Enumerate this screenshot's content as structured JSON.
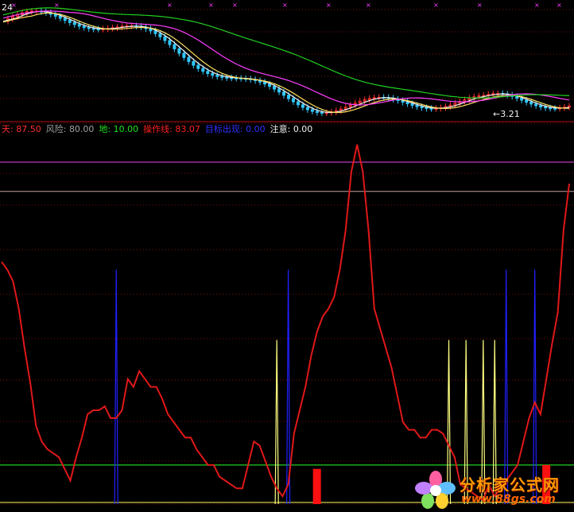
{
  "colors": {
    "background": "#000000",
    "grid": "#7a1010",
    "candle_up": "#ff3030",
    "candle_down": "#30c8ff",
    "ma_fast": "#f0f0f0",
    "ma_mid": "#ffe060",
    "ma_slow": "#ff40ff",
    "ma_long": "#20d020",
    "main_line": "#e01818",
    "blue_spike": "#2020ff",
    "yellow_spike": "#ffff80",
    "sky_line": "#d040d0",
    "risk_line": "#c8a0a0",
    "ground_line": "#20d020",
    "bottom_line": "#ffff60",
    "red_bar": "#ff1010"
  },
  "price_panel": {
    "top_label": "24",
    "low_marker": "←3.21"
  },
  "legend": [
    {
      "key": "天:",
      "value": "87.50",
      "color": "#ff3030",
      "value_color": "#ff3030"
    },
    {
      "key": "风险:",
      "value": "80.00",
      "color": "#a0a0a0",
      "value_color": "#a0a0a0"
    },
    {
      "key": "地:",
      "value": "10.00",
      "color": "#20e020",
      "value_color": "#20e020"
    },
    {
      "key": "操作线:",
      "value": "83.07",
      "color": "#ff2020",
      "value_color": "#ff2020"
    },
    {
      "key": "目标出现:",
      "value": "0.00",
      "color": "#3030ff",
      "value_color": "#3030ff"
    },
    {
      "key": "注意:",
      "value": "0.00",
      "color": "#f0f0f0",
      "value_color": "#f0f0f0"
    }
  ],
  "chart_data": {
    "type": "line",
    "levels": {
      "sky": 87.5,
      "risk": 80.0,
      "ground": 10.0,
      "bottom": 0.0
    },
    "ylim": [
      0,
      94
    ],
    "x_count": 100,
    "series": [
      {
        "name": "操作线",
        "values": [
          62,
          60,
          57,
          50,
          40,
          31,
          20,
          16,
          14,
          13,
          12,
          9,
          6,
          12,
          17,
          23,
          24,
          24,
          25,
          22,
          22,
          24,
          32,
          30,
          34,
          32,
          30,
          30,
          27,
          23,
          21,
          19,
          17,
          17,
          14,
          12,
          10,
          10,
          7,
          6,
          5,
          4,
          4,
          10,
          16,
          15,
          11,
          7,
          4,
          2,
          5,
          18,
          24,
          30,
          38,
          44,
          48,
          50,
          53,
          60,
          70,
          85,
          92,
          85,
          70,
          50,
          45,
          40,
          35,
          28,
          21,
          19,
          19,
          17,
          17,
          19,
          19,
          18,
          15,
          12,
          5,
          4,
          3,
          2,
          1,
          5,
          2,
          4,
          6,
          8,
          10,
          16,
          22,
          26,
          23,
          32,
          41,
          49,
          70,
          82
        ]
      },
      {
        "name": "目标出现",
        "spikes": [
          {
            "x": 20,
            "value": 60
          },
          {
            "x": 50,
            "value": 60
          },
          {
            "x": 88,
            "value": 60
          },
          {
            "x": 93,
            "value": 60
          }
        ]
      },
      {
        "name": "注意",
        "spikes": [
          {
            "x": 48,
            "value": 42
          },
          {
            "x": 78,
            "value": 42
          },
          {
            "x": 81,
            "value": 42
          },
          {
            "x": 84,
            "value": 42
          },
          {
            "x": 86,
            "value": 42
          }
        ]
      }
    ],
    "bars": [
      {
        "x": 55,
        "value": 9
      },
      {
        "x": 95,
        "value": 10
      }
    ]
  },
  "watermark": {
    "title": "分析家公式网",
    "url": "www.88gs.com"
  }
}
